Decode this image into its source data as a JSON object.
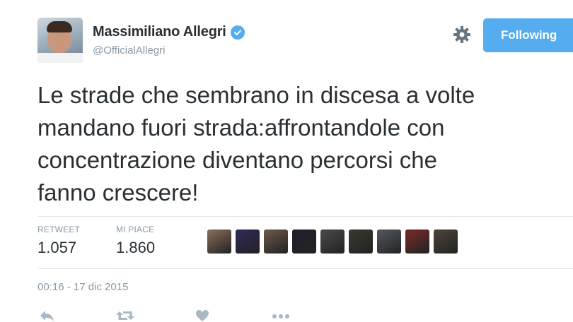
{
  "user": {
    "name": "Massimiliano Allegri",
    "handle": "@OfficialAllegri",
    "verified_color": "#55acee"
  },
  "header": {
    "follow_button_label": "Following",
    "settings_icon": "gear-icon"
  },
  "tweet": {
    "lines": [
      "Le strade che sembrano in discesa a volte",
      "mandano fuori strada:affrontandole con",
      "concentrazione diventano percorsi che",
      "fanno crescere!"
    ],
    "timestamp": "00:16 - 17 dic 2015"
  },
  "stats": {
    "retweets": {
      "label": "RETWEET",
      "value": "1.057"
    },
    "likes": {
      "label": "MI PIACE",
      "value": "1.860"
    }
  },
  "likers": [
    {
      "color": "#8a6f5c"
    },
    {
      "color": "#2f2a5a"
    },
    {
      "color": "#6b5a4a"
    },
    {
      "color": "#1f1f2e"
    },
    {
      "color": "#4a4a4a"
    },
    {
      "color": "#3a3a30"
    },
    {
      "color": "#555a5f"
    },
    {
      "color": "#7a2a2a"
    },
    {
      "color": "#4d4538"
    }
  ],
  "actions": [
    {
      "icon": "reply-icon"
    },
    {
      "icon": "retweet-icon"
    },
    {
      "icon": "like-icon"
    },
    {
      "icon": "more-icon"
    }
  ],
  "colors": {
    "accent": "#55acee",
    "muted": "#8899a6",
    "text": "#292f33"
  }
}
